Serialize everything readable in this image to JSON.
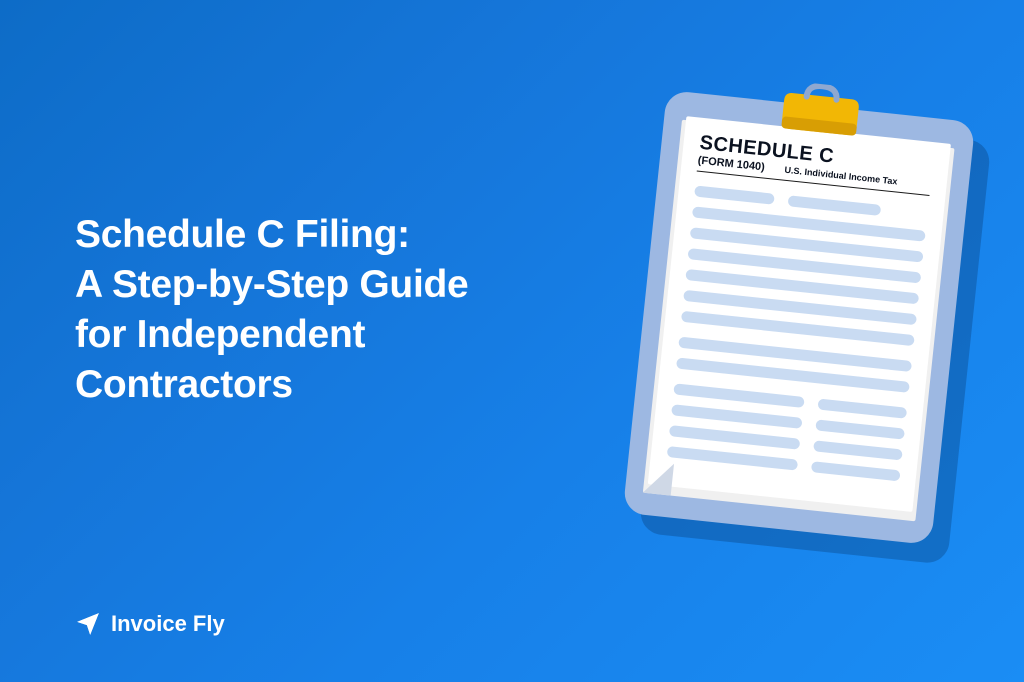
{
  "headline": "Schedule C Filing:\nA Step-by-Step Guide for Independent Contractors",
  "brand": {
    "name": "Invoice Fly"
  },
  "form": {
    "title": "SCHEDULE C",
    "number": "(FORM 1040)",
    "subtitle": "U.S. Individual Income Tax"
  },
  "colors": {
    "bg_start": "#0d6cc7",
    "bg_end": "#1a8df5",
    "clipboard": "#9db8e2",
    "clip_yellow": "#f2b705",
    "line_fill": "#c9dbf2"
  }
}
